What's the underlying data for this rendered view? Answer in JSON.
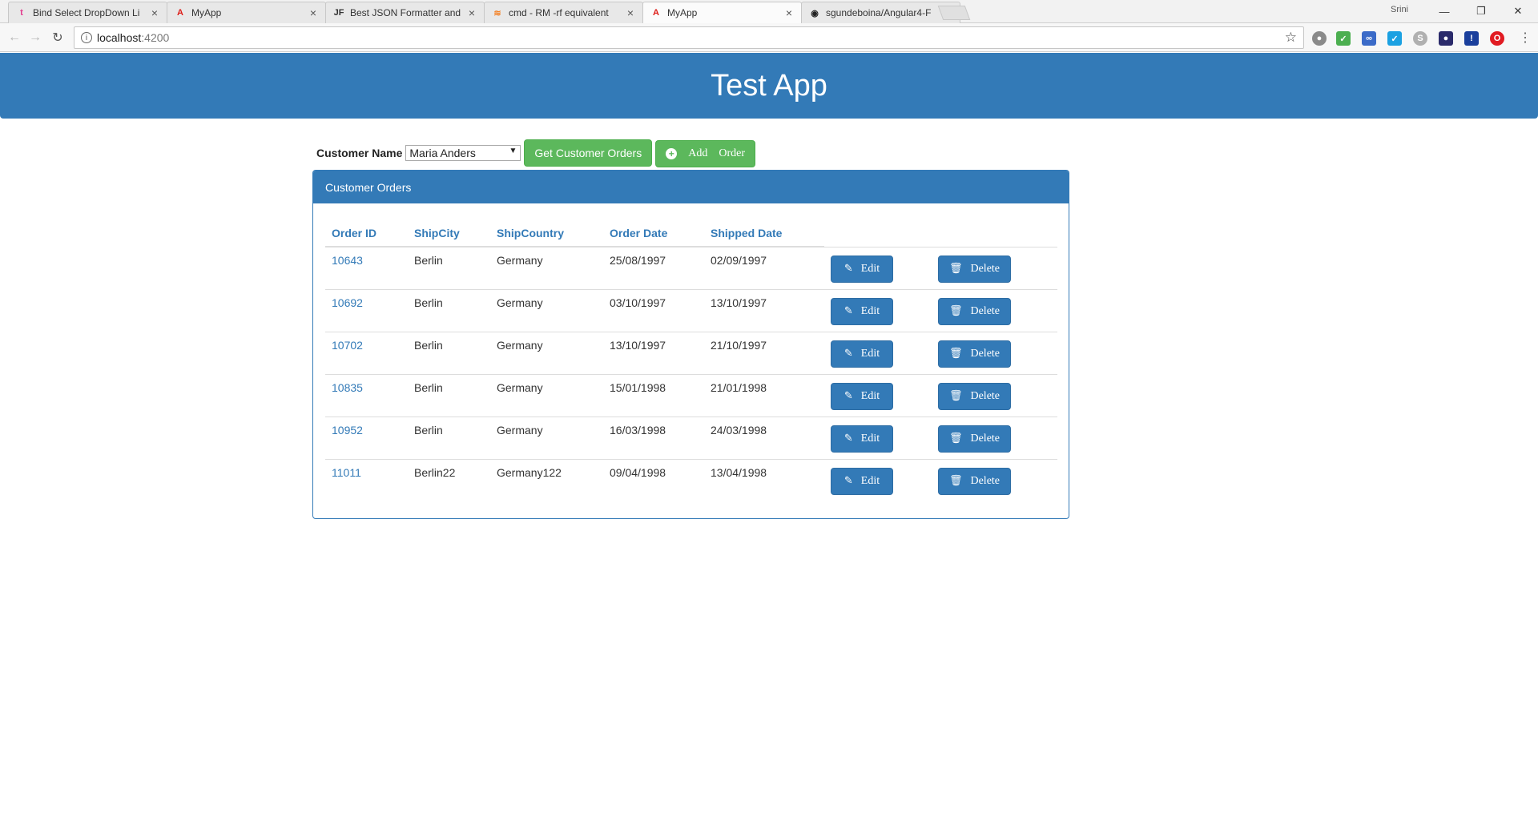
{
  "browser": {
    "tabs": [
      {
        "title": "Bind Select DropDown Li",
        "favicon": "t",
        "favicon_color": "#e23a8c"
      },
      {
        "title": "MyApp",
        "favicon": "A",
        "favicon_color": "#dd1b16"
      },
      {
        "title": "Best JSON Formatter and",
        "favicon": "JF",
        "favicon_color": "#333333"
      },
      {
        "title": "cmd - RM -rf equivalent",
        "favicon": "≋",
        "favicon_color": "#f48024"
      },
      {
        "title": "MyApp",
        "favicon": "A",
        "favicon_color": "#dd1b16",
        "active": true
      },
      {
        "title": "sgundeboina/Angular4-F",
        "favicon": "◉",
        "favicon_color": "#222222"
      }
    ],
    "user": "Srini",
    "url_host": "localhost",
    "url_port": ":4200"
  },
  "app": {
    "title": "Test App"
  },
  "controls": {
    "customer_label": "Customer Name",
    "customer_selected": "Maria Anders",
    "get_orders_label": "Get Customer Orders",
    "add_word1": "Add",
    "add_word2": "Order"
  },
  "panel": {
    "heading": "Customer Orders",
    "columns": [
      "Order ID",
      "ShipCity",
      "ShipCountry",
      "Order Date",
      "Shipped Date"
    ],
    "edit_label": "Edit",
    "delete_label": "Delete",
    "rows": [
      {
        "id": "10643",
        "city": "Berlin",
        "country": "Germany",
        "order_date": "25/08/1997",
        "shipped_date": "02/09/1997"
      },
      {
        "id": "10692",
        "city": "Berlin",
        "country": "Germany",
        "order_date": "03/10/1997",
        "shipped_date": "13/10/1997"
      },
      {
        "id": "10702",
        "city": "Berlin",
        "country": "Germany",
        "order_date": "13/10/1997",
        "shipped_date": "21/10/1997"
      },
      {
        "id": "10835",
        "city": "Berlin",
        "country": "Germany",
        "order_date": "15/01/1998",
        "shipped_date": "21/01/1998"
      },
      {
        "id": "10952",
        "city": "Berlin",
        "country": "Germany",
        "order_date": "16/03/1998",
        "shipped_date": "24/03/1998"
      },
      {
        "id": "11011",
        "city": "Berlin22",
        "country": "Germany122",
        "order_date": "09/04/1998",
        "shipped_date": "13/04/1998"
      }
    ]
  },
  "colors": {
    "primary": "#337ab7",
    "success": "#5cb85c"
  }
}
